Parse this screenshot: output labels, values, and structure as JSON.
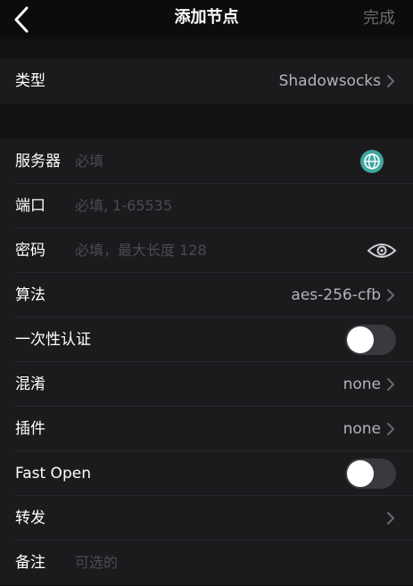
{
  "nav": {
    "title": "添加节点",
    "done_label": "完成",
    "back_icon": "chevron-left-icon"
  },
  "type_row": {
    "label": "类型",
    "value": "Shadowsocks"
  },
  "server": {
    "label": "服务器",
    "placeholder": "必填",
    "icon": "globe-icon",
    "icon_color": "#3fa8a0"
  },
  "port": {
    "label": "端口",
    "placeholder": "必填, 1-65535"
  },
  "password": {
    "label": "密码",
    "placeholder": "必填，最大长度 128",
    "icon": "eye-icon"
  },
  "algorithm": {
    "label": "算法",
    "value": "aes-256-cfb"
  },
  "one_time_auth": {
    "label": "一次性认证",
    "enabled": false
  },
  "obfs": {
    "label": "混淆",
    "value": "none"
  },
  "plugin": {
    "label": "插件",
    "value": "none"
  },
  "fast_open": {
    "label": "Fast Open",
    "enabled": false
  },
  "forward": {
    "label": "转发",
    "value": ""
  },
  "note": {
    "label": "备注",
    "placeholder": "可选的"
  },
  "colors": {
    "background": "#0c0c0e",
    "cell": "#1b1b1e",
    "accent_globe": "#3fa8a0",
    "placeholder": "#4b4b50"
  }
}
